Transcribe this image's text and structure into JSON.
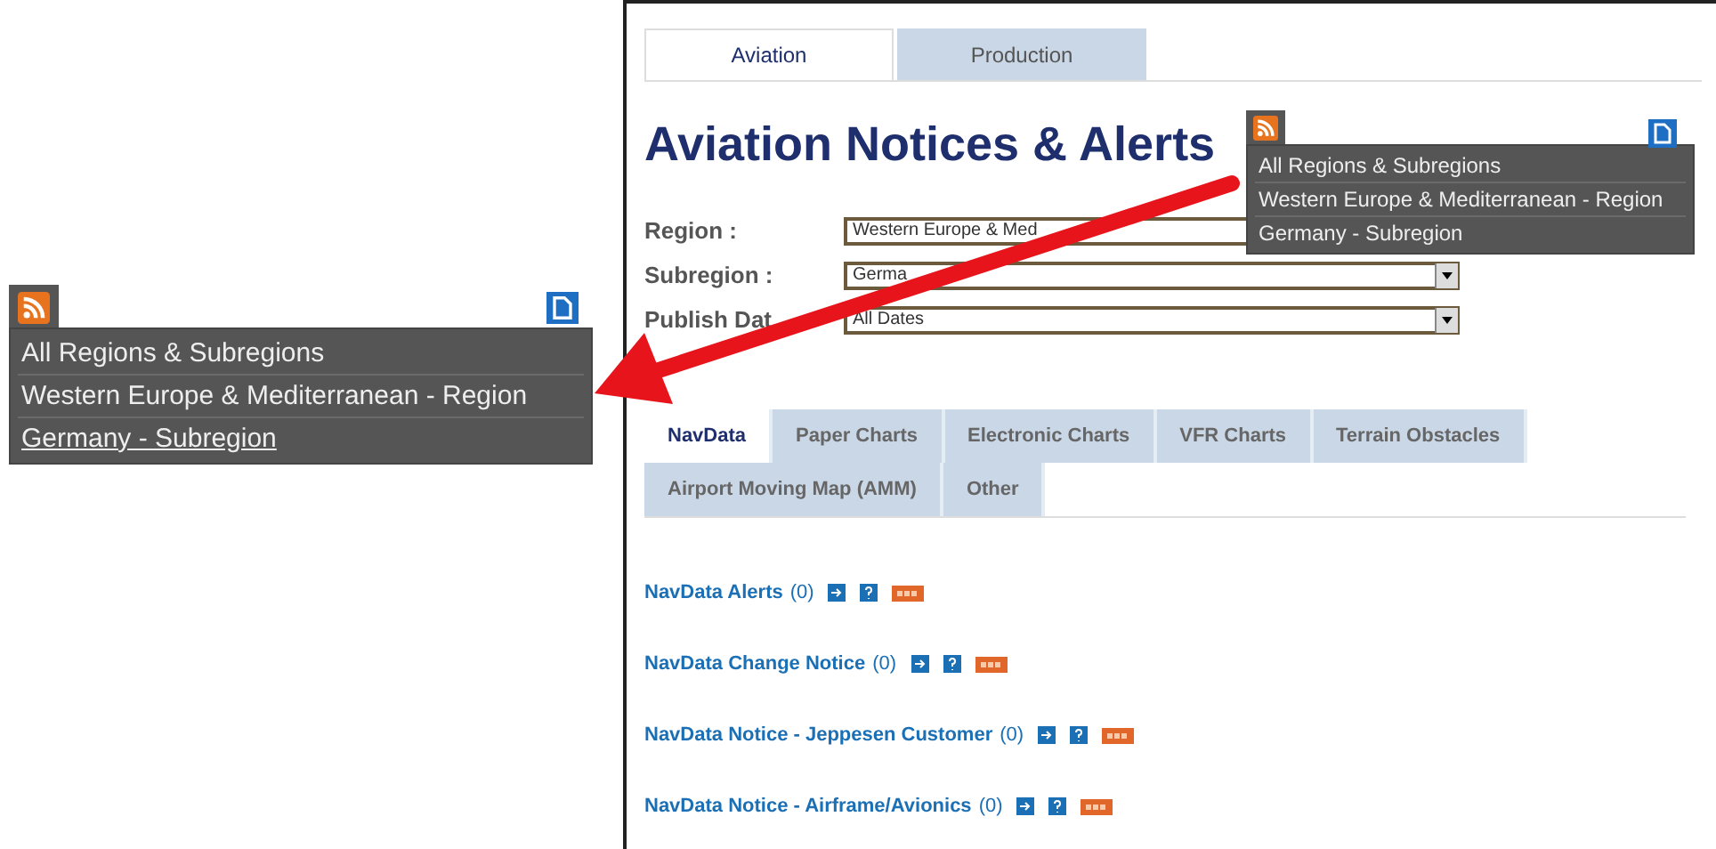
{
  "zoom_callout": {
    "items": [
      {
        "label": "All Regions & Subregions",
        "selected": false
      },
      {
        "label": "Western Europe & Mediterranean - Region",
        "selected": false
      },
      {
        "label": "Germany - Subregion",
        "selected": true
      }
    ]
  },
  "tabs": [
    {
      "label": "Aviation",
      "selected": true
    },
    {
      "label": "Production",
      "selected": false
    }
  ],
  "title": "Aviation Notices & Alerts",
  "feed_menu": {
    "items": [
      {
        "label": "All Regions & Subregions",
        "selected": false
      },
      {
        "label": "Western Europe & Mediterranean - Region",
        "selected": false
      },
      {
        "label": "Germany - Subregion",
        "selected": false
      }
    ]
  },
  "filters": [
    {
      "label": "Region :",
      "value": "Western Europe & Med"
    },
    {
      "label": "Subregion :",
      "value": "Germa"
    },
    {
      "label": "Publish Dat",
      "value": "All Dates"
    }
  ],
  "category_tabs": [
    {
      "label": "NavData",
      "selected": true
    },
    {
      "label": "Paper Charts",
      "selected": false
    },
    {
      "label": "Electronic Charts",
      "selected": false
    },
    {
      "label": "VFR Charts",
      "selected": false
    },
    {
      "label": "Terrain Obstacles",
      "selected": false
    },
    {
      "label": "Airport Moving Map (AMM)",
      "selected": false
    },
    {
      "label": "Other",
      "selected": false
    }
  ],
  "feeds": [
    {
      "title": "NavData Alerts",
      "count": "(0)"
    },
    {
      "title": "NavData Change Notice",
      "count": "(0)"
    },
    {
      "title": "NavData Notice - Jeppesen Customer",
      "count": "(0)"
    },
    {
      "title": "NavData Notice - Airframe/Avionics",
      "count": "(0)"
    }
  ]
}
